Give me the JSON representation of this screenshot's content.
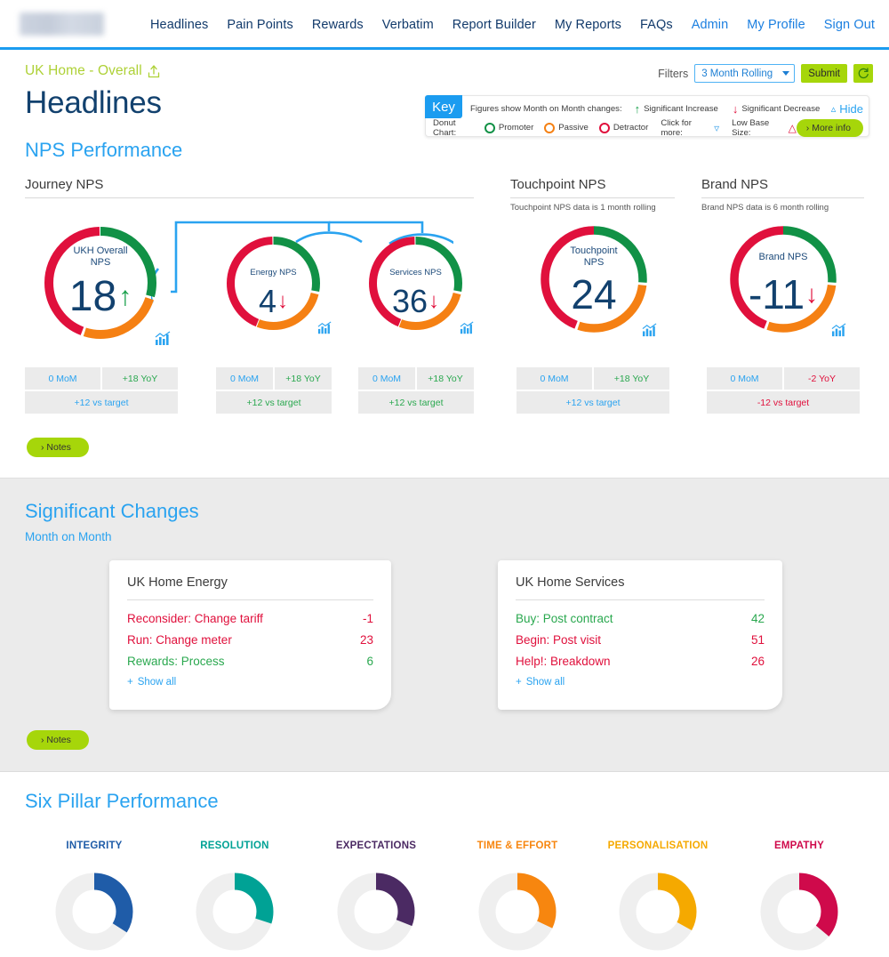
{
  "brand": {
    "logo_alt": ""
  },
  "nav": {
    "items": [
      {
        "label": "Headlines",
        "accent": false
      },
      {
        "label": "Pain Points",
        "accent": false
      },
      {
        "label": "Rewards",
        "accent": false
      },
      {
        "label": "Verbatim",
        "accent": false
      },
      {
        "label": "Report Builder",
        "accent": false
      },
      {
        "label": "My Reports",
        "accent": false
      },
      {
        "label": "FAQs",
        "accent": false
      },
      {
        "label": "Admin",
        "accent": true
      },
      {
        "label": "My Profile",
        "accent": true
      },
      {
        "label": "Sign Out",
        "accent": true
      }
    ]
  },
  "header": {
    "breadcrumb": "UK Home - Overall",
    "title": "Headlines",
    "filters_label": "Filters",
    "filter_value": "3 Month Rolling",
    "filter_options": [
      "3 Month Rolling"
    ],
    "submit_label": "Submit",
    "refresh_icon": "refresh-icon"
  },
  "key": {
    "badge": "Key",
    "figures_text": "Figures show Month on Month changes:",
    "significant_increase": "Significant Increase",
    "significant_decrease": "Significant Decrease",
    "hide_label": "Hide",
    "donut_chart_label": "Donut Chart:",
    "promoter": "Promoter",
    "passive": "Passive",
    "detractor": "Detractor",
    "click_for_more": "Click for more:",
    "low_base_size": "Low Base Size:",
    "more_info": "More info"
  },
  "nps": {
    "section_title": "NPS Performance",
    "columns": [
      {
        "title": "Journey NPS",
        "sub": ""
      },
      {
        "title": "Touchpoint NPS",
        "sub": "Touchpoint NPS data is 1 month rolling"
      },
      {
        "title": "Brand NPS",
        "sub": "Brand NPS data is 6 month rolling"
      }
    ],
    "notes_label": "Notes",
    "donuts": [
      {
        "name": "ukh-overall-nps",
        "label_line1": "UKH Overall",
        "label_line2": "NPS",
        "value": "18",
        "trend": "up",
        "mom": "0 MoM",
        "yoy": "+18 YoY",
        "target": "+12 vs target",
        "mom_color": "blue",
        "yoy_color": "green",
        "target_color": "blue",
        "promoter_pct": 29,
        "passive_pct": 25,
        "detractor_pct": 46
      },
      {
        "name": "energy-nps",
        "label_line1": "Energy NPS",
        "label_line2": "",
        "value": "4",
        "trend": "down",
        "mom": "0 MoM",
        "yoy": "+18 YoY",
        "target": "+12 vs target",
        "mom_color": "blue",
        "yoy_color": "green",
        "target_color": "green",
        "promoter_pct": 28,
        "passive_pct": 27,
        "detractor_pct": 45
      },
      {
        "name": "services-nps",
        "label_line1": "Services NPS",
        "label_line2": "",
        "value": "36",
        "trend": "down",
        "mom": "0 MoM",
        "yoy": "+18 YoY",
        "target": "+12 vs target",
        "mom_color": "blue",
        "yoy_color": "green",
        "target_color": "green",
        "promoter_pct": 28,
        "passive_pct": 27,
        "detractor_pct": 45
      },
      {
        "name": "touchpoint-nps",
        "label_line1": "Touchpoint",
        "label_line2": "NPS",
        "value": "24",
        "trend": "none",
        "mom": "0 MoM",
        "yoy": "+18 YoY",
        "target": "+12 vs target",
        "mom_color": "blue",
        "yoy_color": "green",
        "target_color": "blue",
        "promoter_pct": 26,
        "passive_pct": 28,
        "detractor_pct": 46
      },
      {
        "name": "brand-nps",
        "label_line1": "Brand NPS",
        "label_line2": "",
        "value": "-11",
        "trend": "down",
        "mom": "0 MoM",
        "yoy": "-2 YoY",
        "target": "-12 vs target",
        "mom_color": "blue",
        "yoy_color": "red",
        "target_color": "red",
        "promoter_pct": 26,
        "passive_pct": 28,
        "detractor_pct": 46
      }
    ]
  },
  "significant_changes": {
    "title": "Significant Changes",
    "subtitle": "Month on Month",
    "notes_label": "Notes",
    "cards": [
      {
        "title": "UK Home Energy",
        "show_all": "Show all",
        "rows": [
          {
            "label": "Reconsider: Change tariff",
            "value": "-1",
            "color": "red"
          },
          {
            "label": "Run: Change meter",
            "value": "23",
            "color": "red"
          },
          {
            "label": "Rewards: Process",
            "value": "6",
            "color": "green"
          }
        ]
      },
      {
        "title": "UK Home Services",
        "show_all": "Show all",
        "rows": [
          {
            "label": "Buy: Post contract",
            "value": "42",
            "color": "green"
          },
          {
            "label": "Begin: Post visit",
            "value": "51",
            "color": "red"
          },
          {
            "label": "Help!: Breakdown",
            "value": "26",
            "color": "red"
          }
        ]
      }
    ]
  },
  "six_pillar": {
    "title": "Six Pillar Performance",
    "pillars": [
      {
        "label": "INTEGRITY",
        "color": "#1f5ca8",
        "pct": 34
      },
      {
        "label": "RESOLUTION",
        "color": "#00a295",
        "pct": 30
      },
      {
        "label": "EXPECTATIONS",
        "color": "#4b2a63",
        "pct": 31
      },
      {
        "label": "TIME & EFFORT",
        "color": "#f7860f",
        "pct": 32
      },
      {
        "label": "PERSONALISATION",
        "color": "#f5a900",
        "pct": 33
      },
      {
        "label": "EMPATHY",
        "color": "#cf0a4b",
        "pct": 36
      }
    ]
  },
  "colors": {
    "promoter": "#119146",
    "passive": "#f58013",
    "detractor": "#e0103c",
    "accent_blue": "#2aa3f0",
    "navy": "#12416e",
    "lime": "#a6d60a"
  }
}
